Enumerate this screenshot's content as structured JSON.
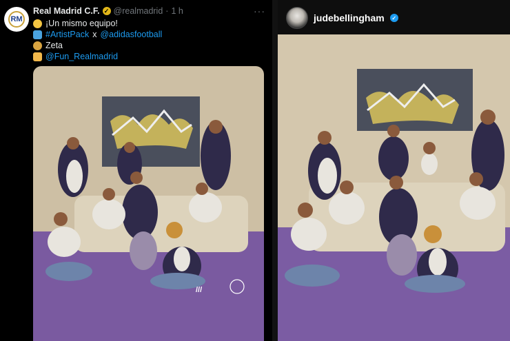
{
  "tweet": {
    "author_name": "Real Madrid C.F.",
    "handle": "@realmadrid",
    "separator": "·",
    "time": "1 h",
    "more": "···",
    "lines": [
      {
        "emoji": "smile-emoji",
        "color": "#f4c542",
        "text": "¡Un mismo equipo!"
      },
      {
        "emoji": "tshirt-emoji",
        "color": "#4aa3df",
        "link_a": "#ArtistPack",
        "joiner": "x",
        "link_b": "@adidasfootball"
      },
      {
        "emoji": "palette-emoji",
        "color": "#d9a441",
        "text": "Zeta"
      },
      {
        "emoji": "handshake-emoji",
        "color": "#f2b84b",
        "link": "@Fun_Realmadrid"
      }
    ]
  },
  "crest_label": "RM",
  "right_panel": {
    "username": "judebellingham"
  },
  "colors": {
    "wall": "#cdbfa4",
    "floor": "#7a5aa0",
    "sofa": "#ddd3bc",
    "painting": "#4a4f5c",
    "link": "#1d9bf0"
  }
}
